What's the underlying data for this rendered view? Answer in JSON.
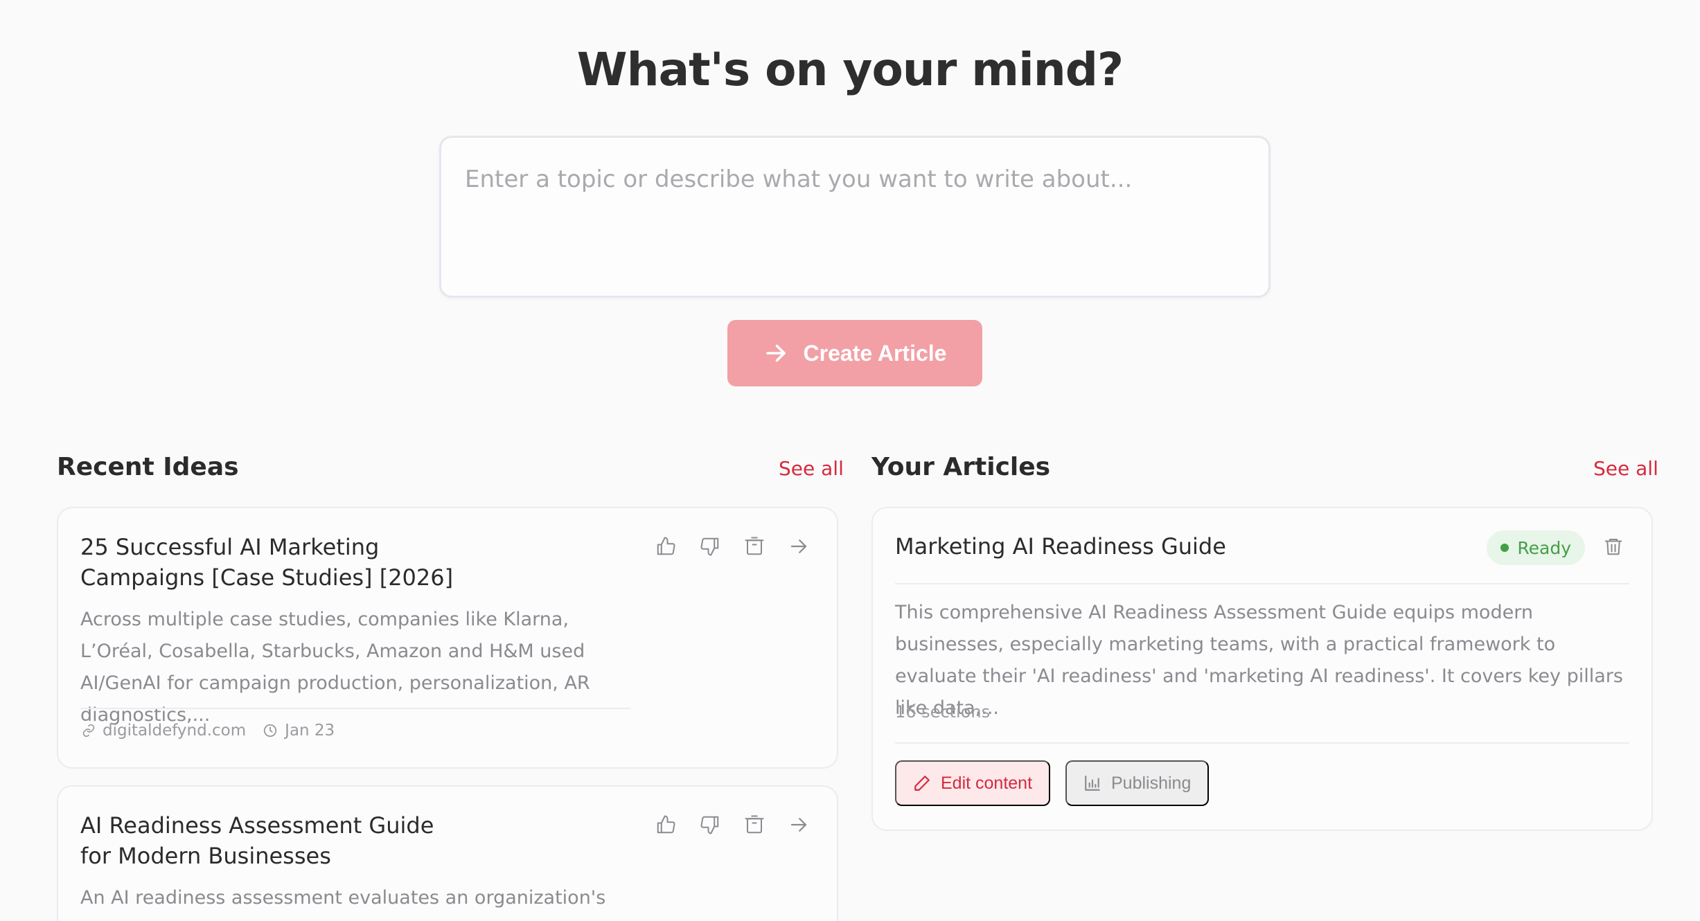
{
  "hero": {
    "title": "What's on your mind?",
    "input_placeholder": "Enter a topic or describe what you want to write about...",
    "input_value": "",
    "create_button_label": "Create Article",
    "create_button_icon": "arrow-right-icon"
  },
  "recent_ideas": {
    "heading": "Recent Ideas",
    "see_all": "See all",
    "items": [
      {
        "title": "25 Successful AI Marketing Campaigns [Case Studies] [2026]",
        "description": "Across multiple case studies, companies like Klarna, L’Oréal, Cosabella, Starbucks, Amazon and H&M used AI/GenAI for campaign production, personalization, AR diagnostics,...",
        "source": "digitaldefynd.com",
        "date": "Jan 23"
      },
      {
        "title": "AI Readiness Assessment Guide for Modern Businesses",
        "description": "An AI readiness assessment evaluates an organization's"
      }
    ]
  },
  "your_articles": {
    "heading": "Your Articles",
    "see_all": "See all",
    "items": [
      {
        "title": "Marketing AI Readiness Guide",
        "status": "Ready",
        "status_color": "#43a047",
        "description": "This comprehensive AI Readiness Assessment Guide equips modern businesses, especially marketing teams, with a practical framework to evaluate their 'AI readiness' and 'marketing AI readiness'. It covers key pillars like data,...",
        "sections": "16 sections",
        "edit_label": "Edit content",
        "publishing_label": "Publishing"
      }
    ]
  },
  "colors": {
    "accent": "#d6293e",
    "button_bg": "#f2a0a6",
    "background": "#fafafa"
  }
}
